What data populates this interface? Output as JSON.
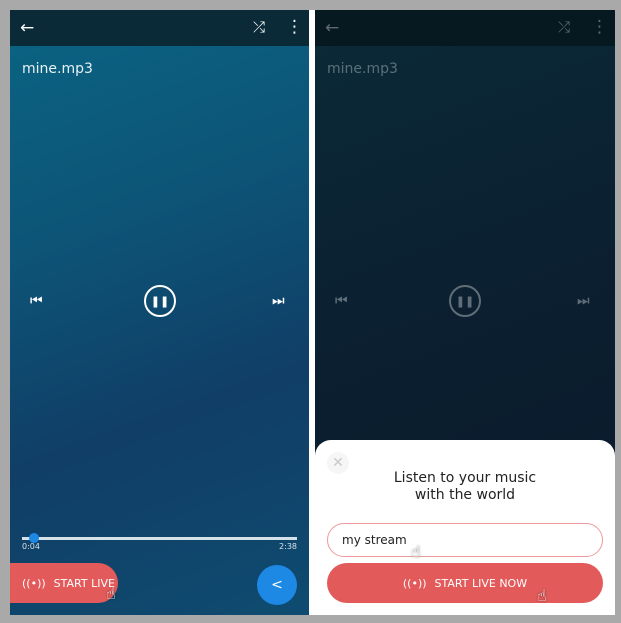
{
  "left": {
    "filename": "mine.mp3",
    "elapsed": "0:04",
    "duration": "2:38",
    "progress": 0.025,
    "start_live_label": "START LIVE"
  },
  "right": {
    "filename": "mine.mp3",
    "sheet_title_line1": "Listen to your music",
    "sheet_title_line2": "with the world",
    "stream_name": "my stream",
    "start_live_now_label": "START LIVE NOW"
  },
  "icons": {
    "back": "←",
    "shuffle": "⤮",
    "more": "⋮",
    "prev": "⏮",
    "pause": "❚❚",
    "next": "⏭",
    "broadcast": "((•))",
    "share": "<",
    "close": "✕",
    "hand": "☝"
  },
  "colors": {
    "accent_red": "#e35a5a",
    "accent_blue": "#1e88e5"
  }
}
